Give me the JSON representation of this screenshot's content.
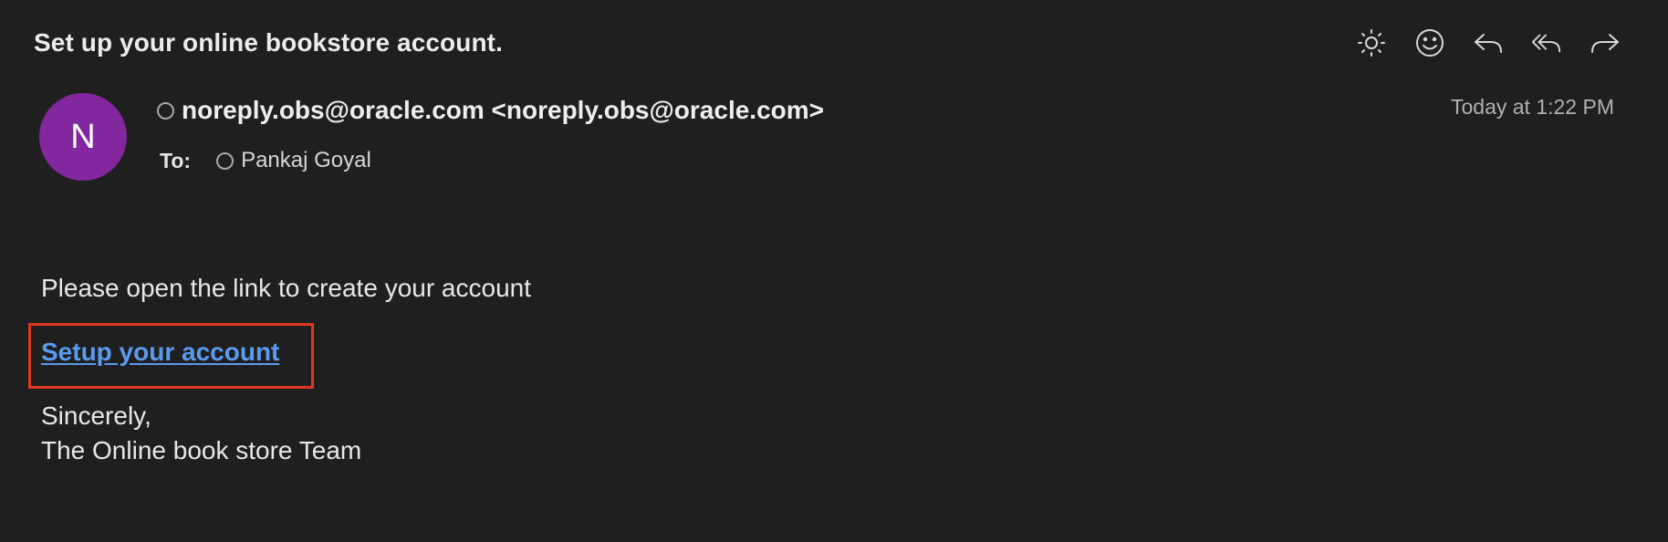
{
  "email": {
    "subject": "Set up your online bookstore account.",
    "avatar_initial": "N",
    "avatar_color": "#82279d",
    "sender": "noreply.obs@oracle.com <noreply.obs@oracle.com>",
    "to_label": "To:",
    "recipient": "Pankaj Goyal",
    "date": "Today at 1:22 PM"
  },
  "toolbar": {
    "icons": [
      "brightness-icon",
      "emoji-icon",
      "reply-icon",
      "reply-all-icon",
      "forward-icon"
    ]
  },
  "body": {
    "intro": "Please open the link to create your account",
    "link_text": "Setup your account",
    "link_color": "#5a9bf0",
    "highlight_color": "#e0381f",
    "signoff": "Sincerely,",
    "signature": "The Online book store Team"
  }
}
